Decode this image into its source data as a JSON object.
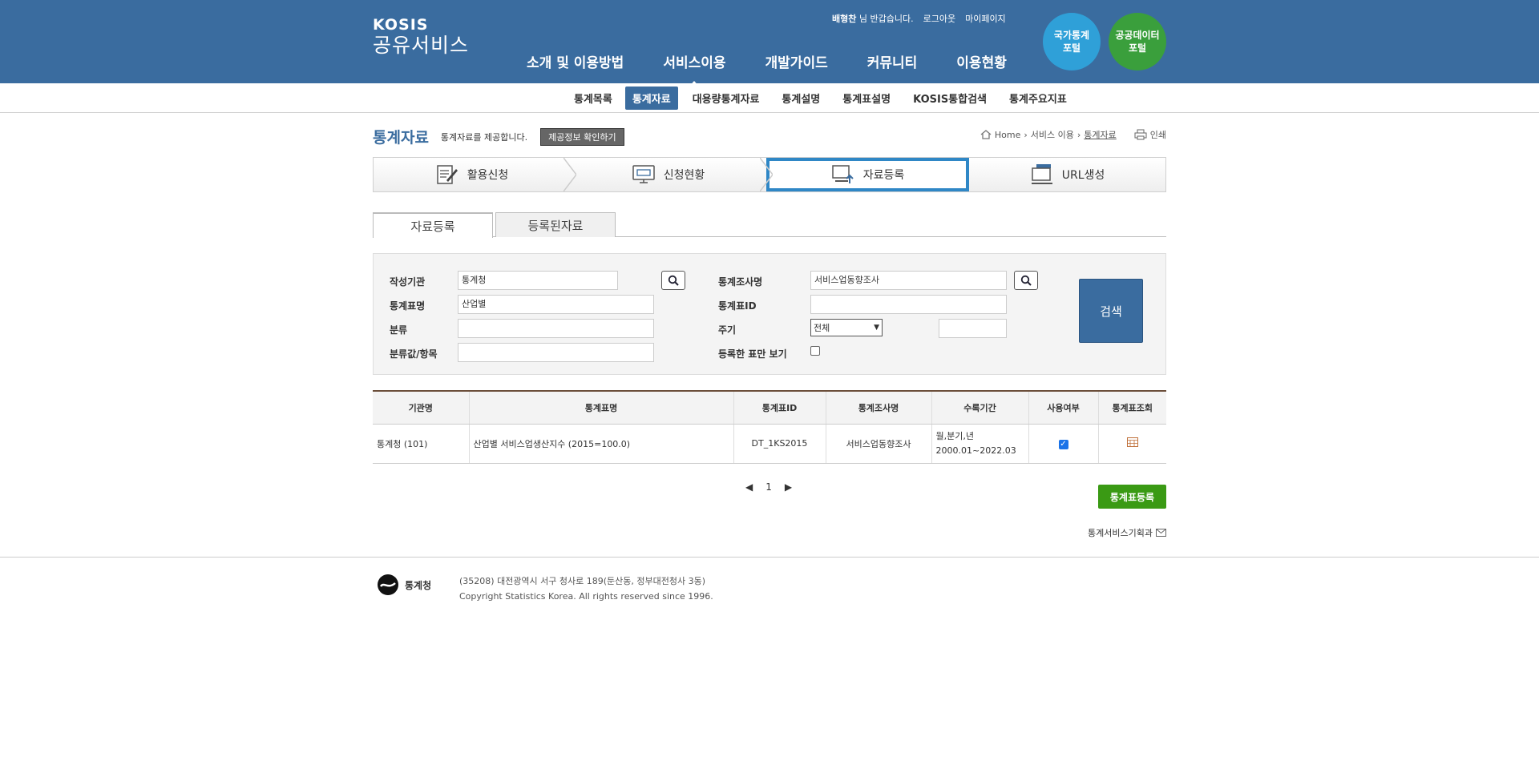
{
  "header": {
    "logo_top": "KOSIS",
    "logo_bottom": "공유서비스",
    "user_name": "배형찬",
    "greeting": "님 반갑습니다.",
    "logout": "로그아웃",
    "mypage": "마이페이지",
    "menu": [
      "소개 및 이용방법",
      "서비스이용",
      "개발가이드",
      "커뮤니티",
      "이용현황"
    ],
    "portal1": "국가통계\n포털",
    "portal2": "공공데이터\n포털"
  },
  "submenu": [
    "통계목록",
    "통계자료",
    "대용량통계자료",
    "통계설명",
    "통계표설명",
    "KOSIS통합검색",
    "통계주요지표"
  ],
  "page": {
    "title": "통계자료",
    "desc": "통계자료를 제공합니다.",
    "info_button": "제공정보 확인하기",
    "breadcrumb": [
      "Home",
      "서비스 이용",
      "통계자료"
    ],
    "print": "인쇄"
  },
  "steps": [
    "활용신청",
    "신청현황",
    "자료등록",
    "URL생성"
  ],
  "tabs": [
    "자료등록",
    "등록된자료"
  ],
  "search": {
    "org_label": "작성기관",
    "org_value": "통계청",
    "survey_label": "통계조사명",
    "survey_value": "서비스업동향조사",
    "tbl_name_label": "통계표명",
    "tbl_name_value": "산업별",
    "tbl_id_label": "통계표ID",
    "tbl_id_value": "",
    "class_label": "분류",
    "class_value": "",
    "cycle_label": "주기",
    "cycle_value": "전체",
    "cycle_extra": "",
    "class_item_label": "분류값/항목",
    "class_item_value": "",
    "registered_only_label": "등록한 표만 보기",
    "search_button": "검색"
  },
  "table": {
    "headers": [
      "기관명",
      "통계표명",
      "통계표ID",
      "통계조사명",
      "수록기간",
      "사용여부",
      "통계표조회"
    ],
    "rows": [
      {
        "org": "통계청 (101)",
        "name": "산업별 서비스업생산지수 (2015=100.0)",
        "id": "DT_1KS2015",
        "survey": "서비스업동향조사",
        "period_1": "월,분기,년",
        "period_2": "2000.01~2022.03"
      }
    ]
  },
  "pager": {
    "current": "1"
  },
  "register_button": "통계표등록",
  "dept": "통계서비스기획과",
  "footer": {
    "org": "통계청",
    "address": "(35208) 대전광역시 서구 청사로 189(둔산동, 정부대전청사 3동)",
    "copyright": "Copyright Statistics Korea. All rights reserved since 1996."
  }
}
